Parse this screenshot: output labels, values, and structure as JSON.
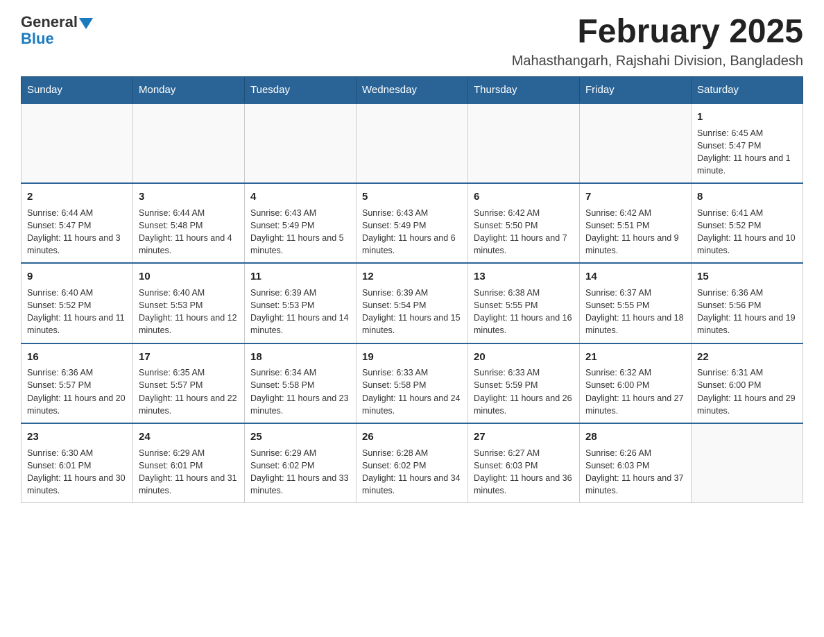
{
  "logo": {
    "general": "General",
    "blue": "Blue"
  },
  "header": {
    "month_title": "February 2025",
    "location": "Mahasthangarh, Rajshahi Division, Bangladesh"
  },
  "weekdays": [
    "Sunday",
    "Monday",
    "Tuesday",
    "Wednesday",
    "Thursday",
    "Friday",
    "Saturday"
  ],
  "weeks": [
    [
      {
        "day": "",
        "info": ""
      },
      {
        "day": "",
        "info": ""
      },
      {
        "day": "",
        "info": ""
      },
      {
        "day": "",
        "info": ""
      },
      {
        "day": "",
        "info": ""
      },
      {
        "day": "",
        "info": ""
      },
      {
        "day": "1",
        "info": "Sunrise: 6:45 AM\nSunset: 5:47 PM\nDaylight: 11 hours and 1 minute."
      }
    ],
    [
      {
        "day": "2",
        "info": "Sunrise: 6:44 AM\nSunset: 5:47 PM\nDaylight: 11 hours and 3 minutes."
      },
      {
        "day": "3",
        "info": "Sunrise: 6:44 AM\nSunset: 5:48 PM\nDaylight: 11 hours and 4 minutes."
      },
      {
        "day": "4",
        "info": "Sunrise: 6:43 AM\nSunset: 5:49 PM\nDaylight: 11 hours and 5 minutes."
      },
      {
        "day": "5",
        "info": "Sunrise: 6:43 AM\nSunset: 5:49 PM\nDaylight: 11 hours and 6 minutes."
      },
      {
        "day": "6",
        "info": "Sunrise: 6:42 AM\nSunset: 5:50 PM\nDaylight: 11 hours and 7 minutes."
      },
      {
        "day": "7",
        "info": "Sunrise: 6:42 AM\nSunset: 5:51 PM\nDaylight: 11 hours and 9 minutes."
      },
      {
        "day": "8",
        "info": "Sunrise: 6:41 AM\nSunset: 5:52 PM\nDaylight: 11 hours and 10 minutes."
      }
    ],
    [
      {
        "day": "9",
        "info": "Sunrise: 6:40 AM\nSunset: 5:52 PM\nDaylight: 11 hours and 11 minutes."
      },
      {
        "day": "10",
        "info": "Sunrise: 6:40 AM\nSunset: 5:53 PM\nDaylight: 11 hours and 12 minutes."
      },
      {
        "day": "11",
        "info": "Sunrise: 6:39 AM\nSunset: 5:53 PM\nDaylight: 11 hours and 14 minutes."
      },
      {
        "day": "12",
        "info": "Sunrise: 6:39 AM\nSunset: 5:54 PM\nDaylight: 11 hours and 15 minutes."
      },
      {
        "day": "13",
        "info": "Sunrise: 6:38 AM\nSunset: 5:55 PM\nDaylight: 11 hours and 16 minutes."
      },
      {
        "day": "14",
        "info": "Sunrise: 6:37 AM\nSunset: 5:55 PM\nDaylight: 11 hours and 18 minutes."
      },
      {
        "day": "15",
        "info": "Sunrise: 6:36 AM\nSunset: 5:56 PM\nDaylight: 11 hours and 19 minutes."
      }
    ],
    [
      {
        "day": "16",
        "info": "Sunrise: 6:36 AM\nSunset: 5:57 PM\nDaylight: 11 hours and 20 minutes."
      },
      {
        "day": "17",
        "info": "Sunrise: 6:35 AM\nSunset: 5:57 PM\nDaylight: 11 hours and 22 minutes."
      },
      {
        "day": "18",
        "info": "Sunrise: 6:34 AM\nSunset: 5:58 PM\nDaylight: 11 hours and 23 minutes."
      },
      {
        "day": "19",
        "info": "Sunrise: 6:33 AM\nSunset: 5:58 PM\nDaylight: 11 hours and 24 minutes."
      },
      {
        "day": "20",
        "info": "Sunrise: 6:33 AM\nSunset: 5:59 PM\nDaylight: 11 hours and 26 minutes."
      },
      {
        "day": "21",
        "info": "Sunrise: 6:32 AM\nSunset: 6:00 PM\nDaylight: 11 hours and 27 minutes."
      },
      {
        "day": "22",
        "info": "Sunrise: 6:31 AM\nSunset: 6:00 PM\nDaylight: 11 hours and 29 minutes."
      }
    ],
    [
      {
        "day": "23",
        "info": "Sunrise: 6:30 AM\nSunset: 6:01 PM\nDaylight: 11 hours and 30 minutes."
      },
      {
        "day": "24",
        "info": "Sunrise: 6:29 AM\nSunset: 6:01 PM\nDaylight: 11 hours and 31 minutes."
      },
      {
        "day": "25",
        "info": "Sunrise: 6:29 AM\nSunset: 6:02 PM\nDaylight: 11 hours and 33 minutes."
      },
      {
        "day": "26",
        "info": "Sunrise: 6:28 AM\nSunset: 6:02 PM\nDaylight: 11 hours and 34 minutes."
      },
      {
        "day": "27",
        "info": "Sunrise: 6:27 AM\nSunset: 6:03 PM\nDaylight: 11 hours and 36 minutes."
      },
      {
        "day": "28",
        "info": "Sunrise: 6:26 AM\nSunset: 6:03 PM\nDaylight: 11 hours and 37 minutes."
      },
      {
        "day": "",
        "info": ""
      }
    ]
  ]
}
